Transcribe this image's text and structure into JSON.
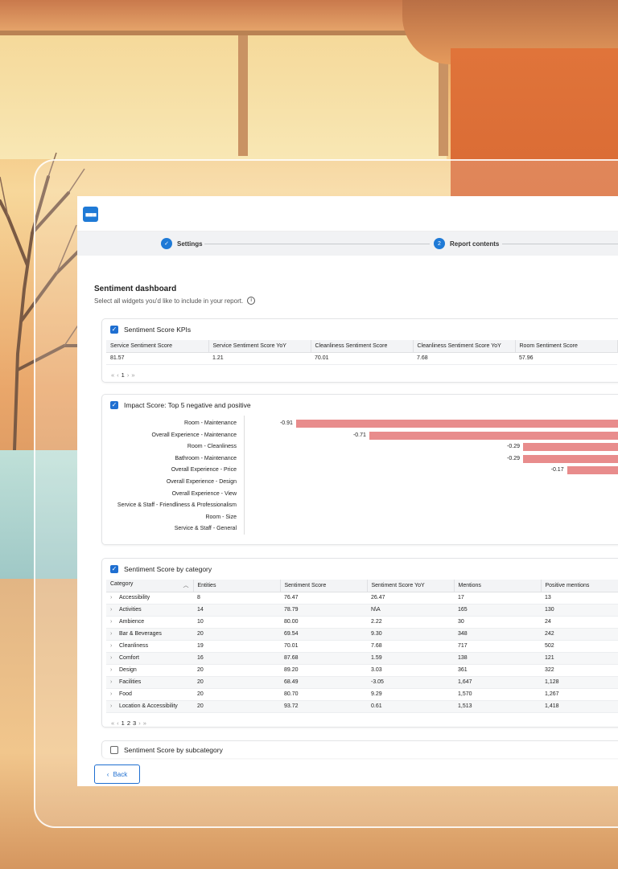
{
  "colors": {
    "accent": "#1f6fd1",
    "negative_bar": "#e88c8c",
    "positive_bar": "#74c3b3"
  },
  "stepper": {
    "steps": [
      {
        "label": "Settings",
        "state": "done",
        "icon": "check-icon"
      },
      {
        "label": "Report contents",
        "state": "current",
        "number": "2"
      }
    ]
  },
  "page": {
    "title": "Sentiment dashboard",
    "subtitle": "Select all widgets you'd like to include in your report.",
    "info_icon": "info-icon"
  },
  "kpis": {
    "title": "Sentiment Score KPIs",
    "checked": true,
    "headers": [
      "Service Sentiment Score",
      "Service Sentiment Score YoY",
      "Cleanliness Sentiment Score",
      "Cleanliness Sentiment Score YoY",
      "Room Sentiment Score"
    ],
    "values": [
      "81.57",
      "1.21",
      "70.01",
      "7.68",
      "57.96"
    ],
    "pager": {
      "first": "«",
      "prev": "‹",
      "page": "1",
      "next": "›",
      "last": "»"
    }
  },
  "impact": {
    "title": "Impact Score: Top 5 negative and positive",
    "checked": true,
    "chart_data": {
      "type": "bar",
      "orientation": "horizontal",
      "categories": [
        "Room - Maintenance",
        "Overall Experience - Maintenance",
        "Room - Cleanliness",
        "Bathroom - Maintenance",
        "Overall Experience - Price",
        "Overall Experience - Design",
        "Overall Experience - View",
        "Service & Staff - Friendliness & Professionalism",
        "Room - Size",
        "Service & Staff - General"
      ],
      "values": [
        -0.91,
        -0.71,
        -0.29,
        -0.29,
        -0.17,
        null,
        null,
        null,
        null,
        null
      ],
      "value_labels": [
        "-0.91",
        "-0.71",
        "-0.29",
        "-0.29",
        "-0.17",
        "",
        "",
        "",
        "",
        ""
      ],
      "xlim": [
        -0.91,
        0
      ],
      "grid": false
    }
  },
  "category": {
    "title": "Sentiment Score by category",
    "checked": true,
    "headers": [
      "Category",
      "Entities",
      "Sentiment Score",
      "Sentiment Score YoY",
      "Mentions",
      "Positive mentions"
    ],
    "sort_icon": "chevron-up-icon",
    "rows": [
      [
        "Accessibility",
        "8",
        "76.47",
        "26.47",
        "17",
        "13"
      ],
      [
        "Activities",
        "14",
        "78.79",
        "N\\A",
        "165",
        "130"
      ],
      [
        "Ambience",
        "10",
        "80.00",
        "2.22",
        "30",
        "24"
      ],
      [
        "Bar & Beverages",
        "20",
        "69.54",
        "9.30",
        "348",
        "242"
      ],
      [
        "Cleanliness",
        "19",
        "70.01",
        "7.68",
        "717",
        "502"
      ],
      [
        "Comfort",
        "16",
        "87.68",
        "1.59",
        "138",
        "121"
      ],
      [
        "Design",
        "20",
        "89.20",
        "3.03",
        "361",
        "322"
      ],
      [
        "Facilities",
        "20",
        "68.49",
        "-3.05",
        "1,647",
        "1,128"
      ],
      [
        "Food",
        "20",
        "80.70",
        "9.29",
        "1,570",
        "1,267"
      ],
      [
        "Location & Accessibility",
        "20",
        "93.72",
        "0.61",
        "1,513",
        "1,418"
      ]
    ],
    "pager": {
      "first": "«",
      "prev": "‹",
      "pages": [
        "1",
        "2",
        "3"
      ],
      "next": "›",
      "last": "»"
    }
  },
  "subcategory": {
    "title": "Sentiment Score by subcategory",
    "checked": false
  },
  "footer": {
    "back_label": "Back"
  }
}
